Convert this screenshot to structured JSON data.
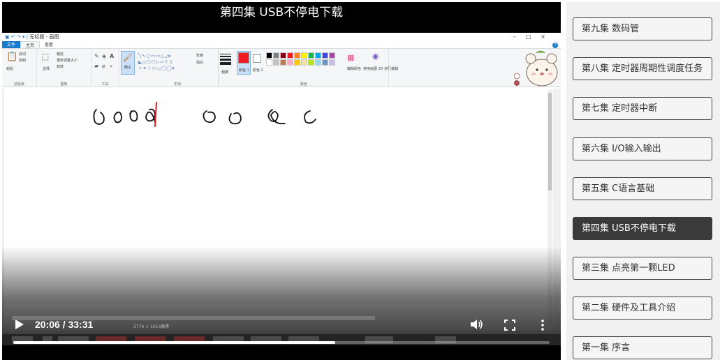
{
  "video": {
    "title": "第四集 USB不停电下载",
    "time_display": "20:06 / 33:31",
    "progress": 0.6,
    "buffered": 0.68,
    "volume": 0.8
  },
  "paint_app": {
    "window_title": "无标题 - 画图",
    "tabs": [
      "文件",
      "主页",
      "查看"
    ],
    "groups": {
      "clipboard": "剪贴板",
      "image": "图像",
      "tools": "工具",
      "shapes": "形状",
      "colors": "颜色"
    },
    "labels": {
      "paste": "粘贴",
      "cut": "剪切",
      "copy": "复制",
      "select": "选择",
      "crop": "裁剪",
      "resize": "重新调整大小",
      "rotate": "旋转",
      "brushes": "刷子",
      "outline": "轮廓",
      "fill": "填充",
      "size": "粗细",
      "color1": "颜色 1",
      "color2": "颜色 2",
      "edit_colors": "编辑颜色",
      "paint3d": "使用画图 3D 进行编辑",
      "canvas_size": "2776 × 1016像素"
    },
    "palette": [
      "#000000",
      "#7f7f7f",
      "#880015",
      "#ed1c24",
      "#ff7f27",
      "#fff200",
      "#22b14c",
      "#00a2e8",
      "#3f48cc",
      "#a349a4",
      "#ffffff",
      "#c3c3c3",
      "#b97a57",
      "#ffaec9",
      "#ffc90e",
      "#efe4b0",
      "#b5e61d",
      "#99d9ea",
      "#7092be",
      "#c8bfe7"
    ],
    "color1": "#ed1c24",
    "color2": "#ffffff"
  },
  "playlist": {
    "episodes": [
      {
        "label": "第九集 数码管",
        "active": false
      },
      {
        "label": "第八集 定时器周期性调度任务",
        "active": false
      },
      {
        "label": "第七集 定时器中断",
        "active": false
      },
      {
        "label": "第六集 I/O输入输出",
        "active": false
      },
      {
        "label": "第五集 C语言基础",
        "active": false
      },
      {
        "label": "第四集 USB不停电下载",
        "active": true
      },
      {
        "label": "第三集 点亮第一颗LED",
        "active": false
      },
      {
        "label": "第二集 硬件及工具介绍",
        "active": false
      },
      {
        "label": "第一集 序言",
        "active": false
      }
    ]
  }
}
